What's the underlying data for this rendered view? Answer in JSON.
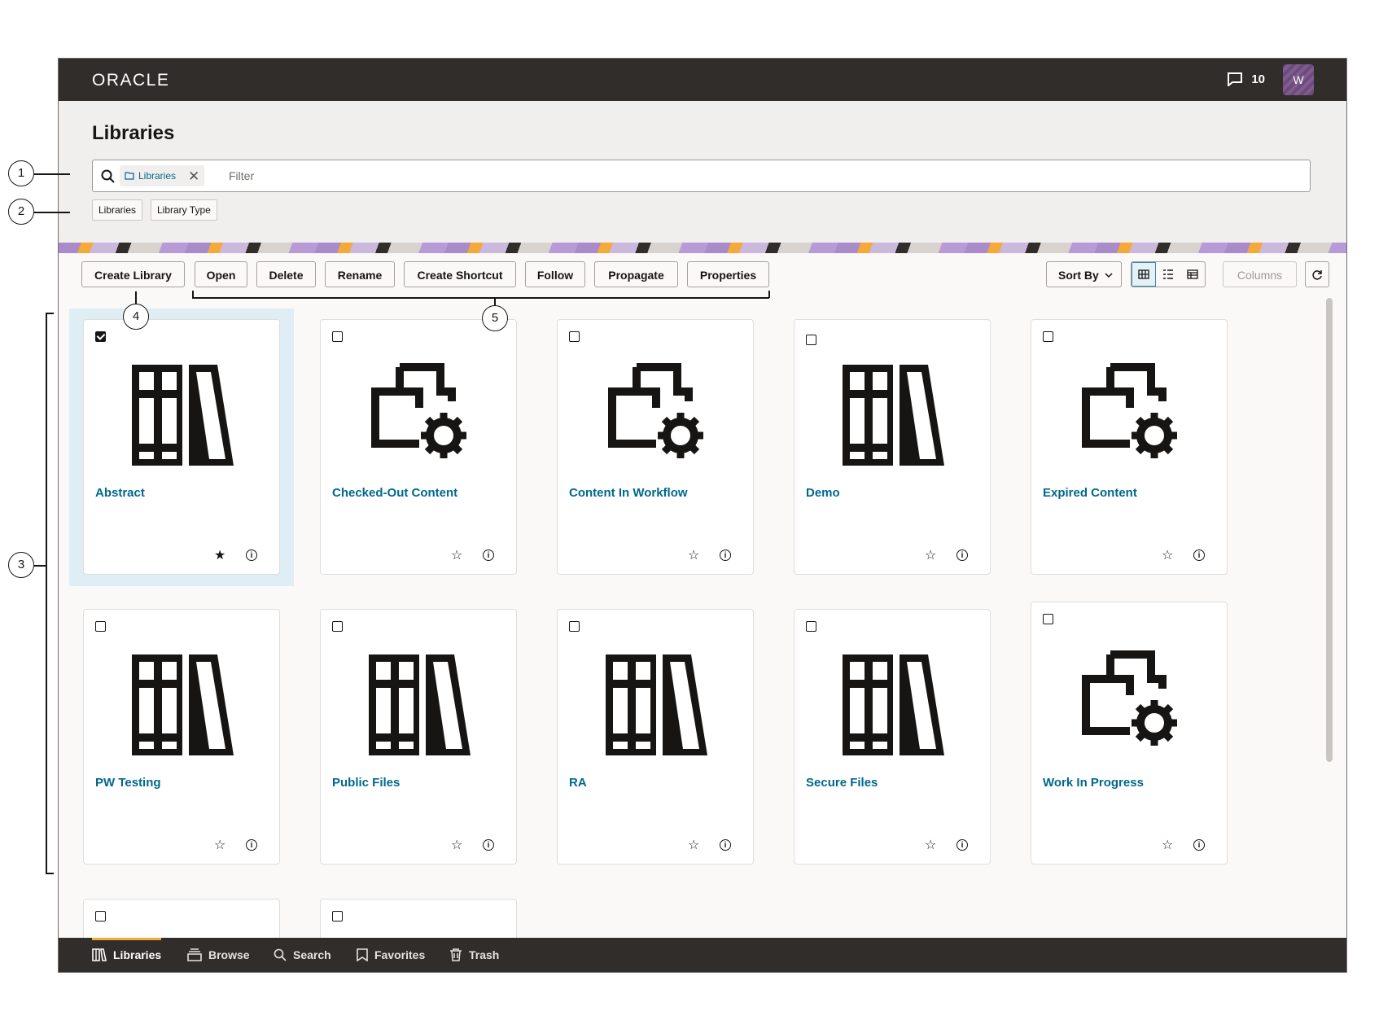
{
  "app": {
    "logo": "ORACLE",
    "notification_count": "10",
    "avatar_initial": "W"
  },
  "page": {
    "title": "Libraries"
  },
  "filter": {
    "chip_label": "Libraries",
    "placeholder": "Filter"
  },
  "facets": [
    "Libraries",
    "Library Type"
  ],
  "toolbar": {
    "buttons": [
      "Create Library",
      "Open",
      "Delete",
      "Rename",
      "Create Shortcut",
      "Follow",
      "Propagate",
      "Properties"
    ],
    "sort_label": "Sort By",
    "columns_label": "Columns"
  },
  "cards": [
    {
      "name": "Abstract",
      "icon": "library-books-icon",
      "selected": true,
      "favorite": true
    },
    {
      "name": "Checked-Out Content",
      "icon": "folder-gear-icon",
      "selected": false,
      "favorite": false
    },
    {
      "name": "Content In Workflow",
      "icon": "folder-gear-icon",
      "selected": false,
      "favorite": false
    },
    {
      "name": "Demo",
      "icon": "library-books-icon",
      "selected": false,
      "favorite": false
    },
    {
      "name": "Expired Content",
      "icon": "folder-gear-icon",
      "selected": false,
      "favorite": false
    },
    {
      "name": "PW Testing",
      "icon": "library-books-icon",
      "selected": false,
      "favorite": false
    },
    {
      "name": "Public Files",
      "icon": "library-books-icon",
      "selected": false,
      "favorite": false
    },
    {
      "name": "RA",
      "icon": "library-books-icon",
      "selected": false,
      "favorite": false
    },
    {
      "name": "Secure Files",
      "icon": "library-books-icon",
      "selected": false,
      "favorite": false
    },
    {
      "name": "Work In Progress",
      "icon": "folder-gear-icon",
      "selected": false,
      "favorite": false
    }
  ],
  "bottom_nav": [
    "Libraries",
    "Browse",
    "Search",
    "Favorites",
    "Trash"
  ],
  "callouts": [
    "1",
    "2",
    "3",
    "4",
    "5"
  ]
}
